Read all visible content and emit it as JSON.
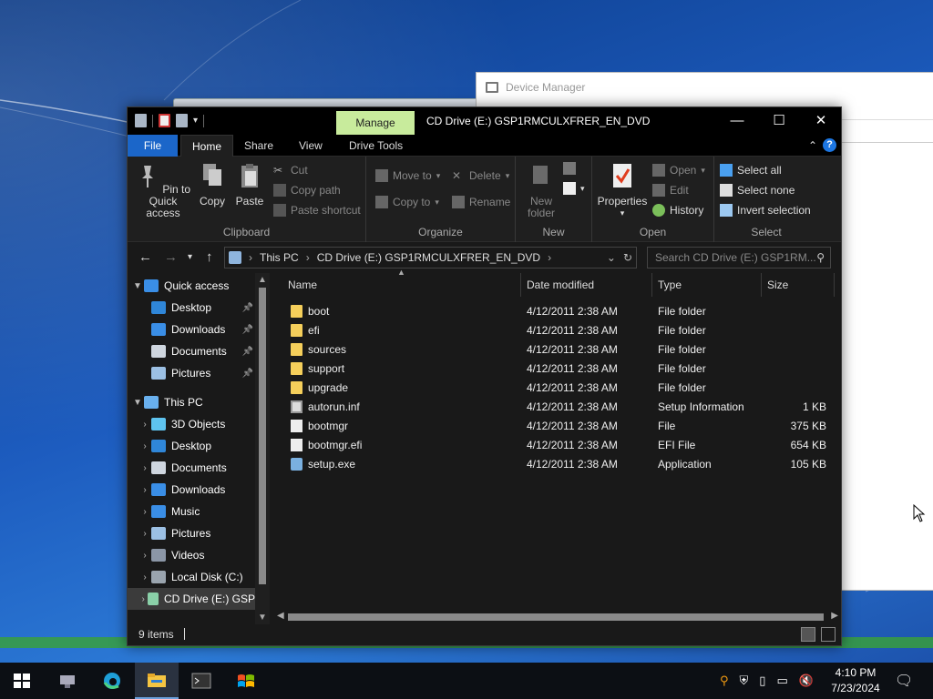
{
  "explorer": {
    "title": "CD Drive (E:) GSP1RMCULXFRER_EN_DVD",
    "manage_tab": "Manage",
    "tabs": [
      "File",
      "Home",
      "Share",
      "View",
      "Drive Tools"
    ],
    "ribbon": {
      "clipboard": {
        "label": "Clipboard",
        "pin": "Pin to Quick access",
        "copy": "Copy",
        "paste": "Paste",
        "cut": "Cut",
        "copy_path": "Copy path",
        "paste_shortcut": "Paste shortcut"
      },
      "organize": {
        "label": "Organize",
        "move_to": "Move to",
        "copy_to": "Copy to",
        "delete": "Delete",
        "rename": "Rename"
      },
      "new": {
        "label": "New",
        "new_folder": "New folder"
      },
      "open": {
        "label": "Open",
        "properties": "Properties",
        "open": "Open",
        "edit": "Edit",
        "history": "History"
      },
      "select": {
        "label": "Select",
        "select_all": "Select all",
        "select_none": "Select none",
        "invert": "Invert selection"
      }
    },
    "address": {
      "crumbs": [
        "This PC",
        "CD Drive (E:) GSP1RMCULXFRER_EN_DVD"
      ]
    },
    "search": {
      "placeholder": "Search CD Drive (E:) GSP1RM..."
    },
    "nav": [
      {
        "label": "Quick access",
        "level": 0,
        "expanded": true,
        "icon": "star-icon",
        "color": "#3a8ee6"
      },
      {
        "label": "Desktop",
        "level": 1,
        "pinned": true,
        "icon": "desktop-icon",
        "color": "#2f86d8"
      },
      {
        "label": "Downloads",
        "level": 1,
        "pinned": true,
        "icon": "download-icon",
        "color": "#3a8ee6"
      },
      {
        "label": "Documents",
        "level": 1,
        "pinned": true,
        "icon": "document-icon",
        "color": "#cfd6df"
      },
      {
        "label": "Pictures",
        "level": 1,
        "pinned": true,
        "icon": "picture-icon",
        "color": "#9cc0e4"
      },
      {
        "label": "This PC",
        "level": 0,
        "expanded": true,
        "icon": "pc-icon",
        "color": "#69b0ee"
      },
      {
        "label": "3D Objects",
        "level": 1,
        "icon": "cube-icon",
        "color": "#5ec3ef"
      },
      {
        "label": "Desktop",
        "level": 1,
        "icon": "desktop-icon",
        "color": "#2f86d8"
      },
      {
        "label": "Documents",
        "level": 1,
        "icon": "document-icon",
        "color": "#cfd6df"
      },
      {
        "label": "Downloads",
        "level": 1,
        "icon": "download-icon",
        "color": "#3a8ee6"
      },
      {
        "label": "Music",
        "level": 1,
        "icon": "music-icon",
        "color": "#3a8ee6"
      },
      {
        "label": "Pictures",
        "level": 1,
        "icon": "picture-icon",
        "color": "#9cc0e4"
      },
      {
        "label": "Videos",
        "level": 1,
        "icon": "video-icon",
        "color": "#8b96a6"
      },
      {
        "label": "Local Disk (C:)",
        "level": 1,
        "icon": "disk-icon",
        "color": "#9aa4ae"
      },
      {
        "label": "CD Drive (E:) GSP",
        "level": 1,
        "selected": true,
        "icon": "cd-icon",
        "color": "#8ad0a8"
      }
    ],
    "columns": [
      "Name",
      "Date modified",
      "Type",
      "Size"
    ],
    "files": [
      {
        "name": "boot",
        "date": "4/12/2011 2:38 AM",
        "type": "File folder",
        "size": "",
        "kind": "folder"
      },
      {
        "name": "efi",
        "date": "4/12/2011 2:38 AM",
        "type": "File folder",
        "size": "",
        "kind": "folder"
      },
      {
        "name": "sources",
        "date": "4/12/2011 2:38 AM",
        "type": "File folder",
        "size": "",
        "kind": "folder"
      },
      {
        "name": "support",
        "date": "4/12/2011 2:38 AM",
        "type": "File folder",
        "size": "",
        "kind": "folder"
      },
      {
        "name": "upgrade",
        "date": "4/12/2011 2:38 AM",
        "type": "File folder",
        "size": "",
        "kind": "folder"
      },
      {
        "name": "autorun.inf",
        "date": "4/12/2011 2:38 AM",
        "type": "Setup Information",
        "size": "1 KB",
        "kind": "inf"
      },
      {
        "name": "bootmgr",
        "date": "4/12/2011 2:38 AM",
        "type": "File",
        "size": "375 KB",
        "kind": "doc"
      },
      {
        "name": "bootmgr.efi",
        "date": "4/12/2011 2:38 AM",
        "type": "EFI File",
        "size": "654 KB",
        "kind": "doc"
      },
      {
        "name": "setup.exe",
        "date": "4/12/2011 2:38 AM",
        "type": "Application",
        "size": "105 KB",
        "kind": "exe"
      }
    ],
    "status": {
      "count": "9 items"
    }
  },
  "background_window": {
    "title": "Device Manager"
  },
  "taskbar": {
    "items": [
      "start-icon",
      "network-icon",
      "edge-icon",
      "file-explorer-icon",
      "terminal-icon",
      "windows-setup-icon"
    ],
    "clock": {
      "time": "4:10 PM",
      "date": "7/23/2024"
    }
  }
}
